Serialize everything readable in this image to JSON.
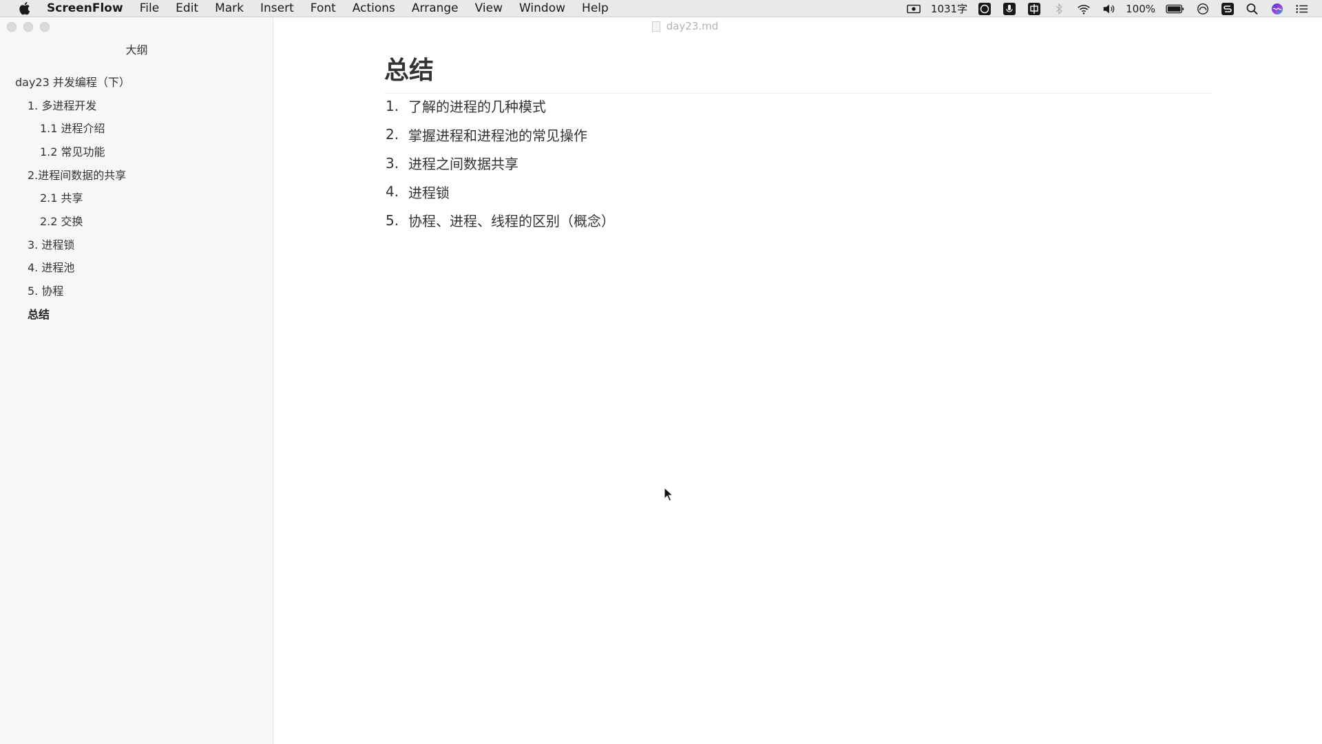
{
  "menubar": {
    "app_name": "ScreenFlow",
    "items": [
      "File",
      "Edit",
      "Mark",
      "Insert",
      "Font",
      "Actions",
      "Arrange",
      "View",
      "Window",
      "Help"
    ],
    "word_count": "1031字",
    "battery": "100%",
    "status_icons": [
      "screen-record-icon",
      "emoji-icon",
      "microphone-icon",
      "input-method-icon",
      "bluetooth-icon",
      "wifi-icon",
      "volume-icon",
      "battery-icon",
      "creative-cloud-icon",
      "sync-icon",
      "spotlight-search-icon",
      "siri-icon",
      "notification-center-icon"
    ]
  },
  "window": {
    "title": "day23.md"
  },
  "sidebar": {
    "title": "大纲",
    "items": [
      {
        "label": "day23 并发编程（下）",
        "level": 1
      },
      {
        "label": "1. 多进程开发",
        "level": 2
      },
      {
        "label": "1.1 进程介绍",
        "level": 3
      },
      {
        "label": "1.2 常见功能",
        "level": 3
      },
      {
        "label": "2.进程间数据的共享",
        "level": 2
      },
      {
        "label": "2.1 共享",
        "level": 3
      },
      {
        "label": "2.2 交换",
        "level": 3
      },
      {
        "label": "3. 进程锁",
        "level": 2
      },
      {
        "label": "4. 进程池",
        "level": 2
      },
      {
        "label": "5. 协程",
        "level": 2
      },
      {
        "label": "总结",
        "level": 2,
        "active": true
      }
    ]
  },
  "editor": {
    "heading": "总结",
    "list": [
      {
        "num": "1.",
        "text": "了解的进程的几种模式"
      },
      {
        "num": "2.",
        "text": "掌握进程和进程池的常见操作"
      },
      {
        "num": "3.",
        "text": "进程之间数据共享"
      },
      {
        "num": "4.",
        "text": "进程锁"
      },
      {
        "num": "5.",
        "text": "协程、进程、线程的区别（概念）"
      }
    ]
  }
}
